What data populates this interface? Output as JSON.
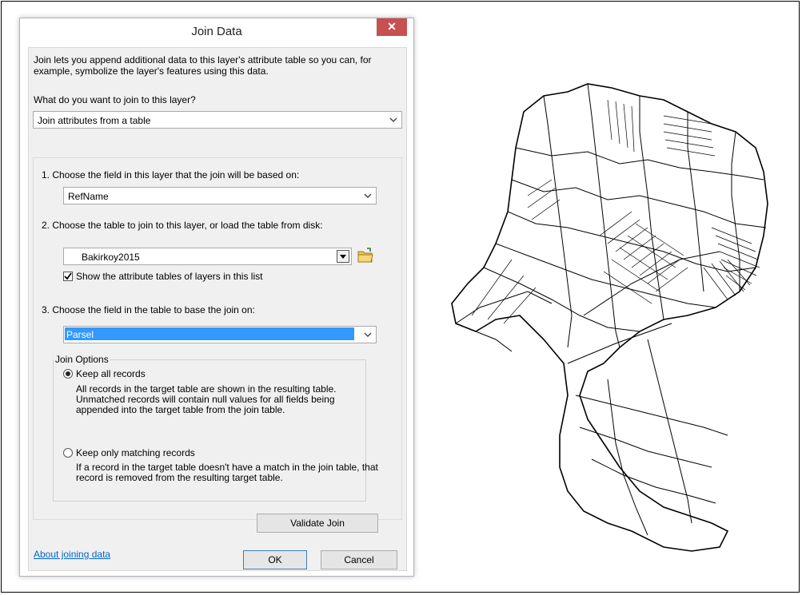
{
  "dialog": {
    "title": "Join Data",
    "close_glyph": "✕",
    "intro": "Join lets you append additional data to this layer's attribute table so you can, for example, symbolize the layer's features using this data.",
    "question": "What do you want to join to this layer?",
    "join_type": "Join attributes from a table",
    "step1_label": "1.  Choose the field in this layer that the join will be based on:",
    "step1_value": "RefName",
    "step2_label": "2.  Choose the table to join to this layer, or load the table from disk:",
    "step2_value": "Bakirkoy2015",
    "show_attr_label": "Show the attribute tables of layers in this list",
    "step3_label": "3.  Choose the field in the table to base the join on:",
    "step3_value": "Parsel",
    "join_options_title": "Join Options",
    "keep_all_label": "Keep all records",
    "keep_all_desc": "All records in the target table are shown in the resulting table. Unmatched records will contain null values for all fields being appended into the target table from the join table.",
    "keep_match_label": "Keep only matching records",
    "keep_match_desc": "If a record in the target table doesn't have a match in the join table, that record is removed from the resulting target table.",
    "validate_label": "Validate Join",
    "about_link": "About joining data",
    "ok_label": "OK",
    "cancel_label": "Cancel"
  },
  "icons": {
    "chevron": "chevron-down-icon",
    "folder": "open-folder-icon",
    "check": "checkmark-icon"
  },
  "colors": {
    "close_button": "#c75050",
    "selection": "#3399ff",
    "link": "#0066cc"
  }
}
